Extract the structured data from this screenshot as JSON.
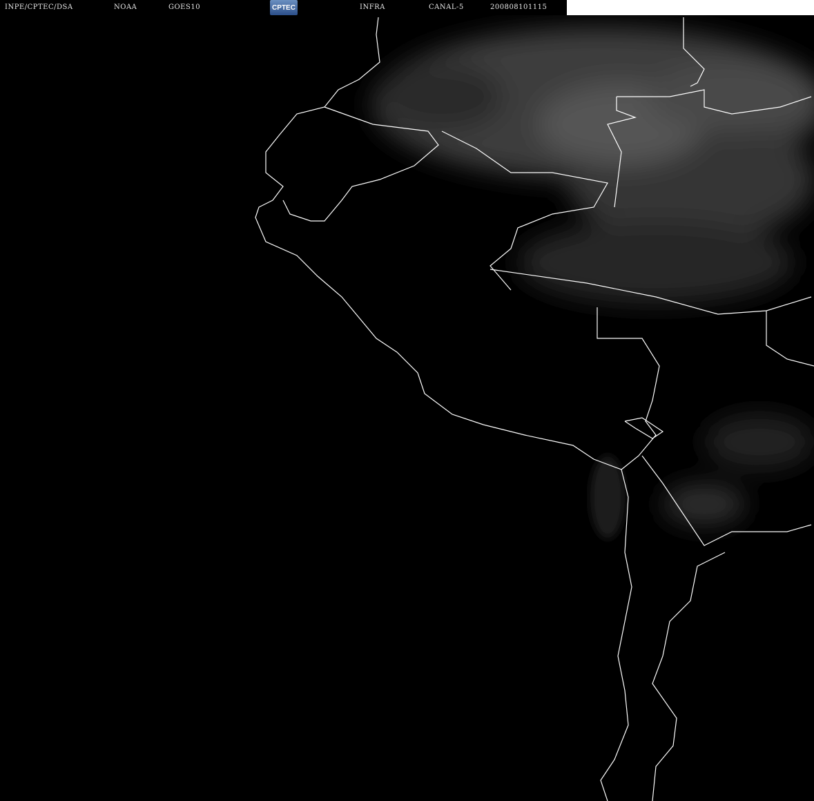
{
  "header": {
    "agency": "INPE/CPTEC/DSA",
    "source": "NOAA",
    "satellite": "GOES10",
    "logo_text": "CPTEC",
    "image_type": "INFRA",
    "channel": "CANAL-5",
    "timestamp": "200808101115"
  },
  "colors": {
    "background": "#000000",
    "borders": "#ffffff",
    "clouds": "#5a5a5a"
  }
}
